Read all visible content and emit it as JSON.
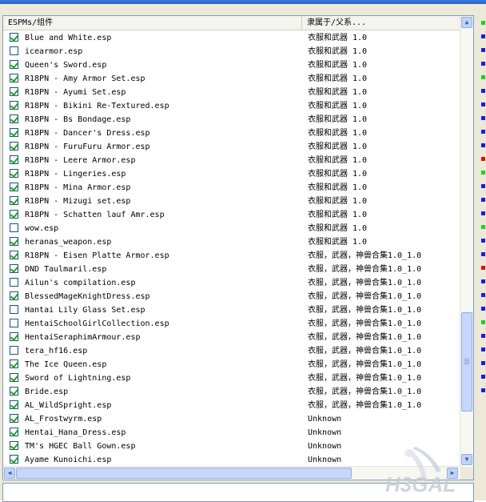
{
  "columns": {
    "name": "ESPMs/组件",
    "master": "隶属于/父系..."
  },
  "rows": [
    {
      "checked": true,
      "name": "Blue and White.esp",
      "master": "衣服和武器 1.0"
    },
    {
      "checked": false,
      "name": "icearmor.esp",
      "master": "衣服和武器 1.0"
    },
    {
      "checked": true,
      "name": "Queen's Sword.esp",
      "master": "衣服和武器 1.0"
    },
    {
      "checked": true,
      "name": "R18PN - Amy Armor Set.esp",
      "master": "衣服和武器 1.0"
    },
    {
      "checked": true,
      "name": "R18PN - Ayumi Set.esp",
      "master": "衣服和武器 1.0"
    },
    {
      "checked": true,
      "name": "R18PN - Bikini Re-Textured.esp",
      "master": "衣服和武器 1.0"
    },
    {
      "checked": true,
      "name": "R18PN - Bs Bondage.esp",
      "master": "衣服和武器 1.0"
    },
    {
      "checked": true,
      "name": "R18PN - Dancer's Dress.esp",
      "master": "衣服和武器 1.0"
    },
    {
      "checked": true,
      "name": "R18PN - FuruFuru Armor.esp",
      "master": "衣服和武器 1.0"
    },
    {
      "checked": true,
      "name": "R18PN - Leere Armor.esp",
      "master": "衣服和武器 1.0"
    },
    {
      "checked": true,
      "name": "R18PN - Lingeries.esp",
      "master": "衣服和武器 1.0"
    },
    {
      "checked": true,
      "name": "R18PN - Mina Armor.esp",
      "master": "衣服和武器 1.0"
    },
    {
      "checked": true,
      "name": "R18PN - Mizugi set.esp",
      "master": "衣服和武器 1.0"
    },
    {
      "checked": true,
      "name": "R18PN - Schatten lauf Amr.esp",
      "master": "衣服和武器 1.0"
    },
    {
      "checked": false,
      "name": "wow.esp",
      "master": "衣服和武器 1.0"
    },
    {
      "checked": true,
      "name": "heranas_weapon.esp",
      "master": "衣服和武器 1.0"
    },
    {
      "checked": true,
      "name": "R18PN - Eisen Platte Armor.esp",
      "master": "衣服，武器，神兽合集1.0_1.0"
    },
    {
      "checked": true,
      "name": "DND Taulmaril.esp",
      "master": "衣服，武器，神兽合集1.0_1.0"
    },
    {
      "checked": false,
      "name": "Ailun's compilation.esp",
      "master": "衣服，武器，神兽合集1.0_1.0"
    },
    {
      "checked": true,
      "name": "BlessedMageKnightDress.esp",
      "master": "衣服，武器，神兽合集1.0_1.0"
    },
    {
      "checked": false,
      "name": "Hantai Lily Glass Set.esp",
      "master": "衣服，武器，神兽合集1.0_1.0"
    },
    {
      "checked": false,
      "name": "HentaiSchoolGirlCollection.esp",
      "master": "衣服，武器，神兽合集1.0_1.0"
    },
    {
      "checked": true,
      "name": "HentaiSeraphimArmour.esp",
      "master": "衣服，武器，神兽合集1.0_1.0"
    },
    {
      "checked": false,
      "name": "tera_hf16.esp",
      "master": "衣服，武器，神兽合集1.0_1.0"
    },
    {
      "checked": true,
      "name": "The Ice Queen.esp",
      "master": "衣服，武器，神兽合集1.0_1.0"
    },
    {
      "checked": true,
      "name": "Sword of Lightning.esp",
      "master": "衣服，武器，神兽合集1.0_1.0"
    },
    {
      "checked": true,
      "name": "Bride.esp",
      "master": "衣服，武器，神兽合集1.0_1.0"
    },
    {
      "checked": true,
      "name": "AL_WildSpright.esp",
      "master": "衣服，武器，神兽合集1.0_1.0"
    },
    {
      "checked": true,
      "name": "AL_Frostwyrm.esp",
      "master": "Unknown"
    },
    {
      "checked": true,
      "name": "Hentai_Hana_Dress.esp",
      "master": "Unknown"
    },
    {
      "checked": true,
      "name": "TM's HGEC Ball Gown.esp",
      "master": "Unknown"
    },
    {
      "checked": true,
      "name": "Ayame Kunoichi.esp",
      "master": "Unknown"
    }
  ],
  "status_indicators": [
    "green",
    "blue",
    "blue",
    "blue",
    "green",
    "blue",
    "blue",
    "blue",
    "blue",
    "blue",
    "red",
    "green",
    "blue",
    "blue",
    "blue",
    "green",
    "blue",
    "blue",
    "red",
    "blue",
    "blue",
    "blue",
    "green",
    "blue",
    "blue",
    "blue",
    "blue",
    "blue"
  ],
  "colors": {
    "green": "#22cc22",
    "blue": "#1a1aee",
    "red": "#e01010",
    "checkmark": "#21a121"
  },
  "watermark_text": "H3GAL"
}
